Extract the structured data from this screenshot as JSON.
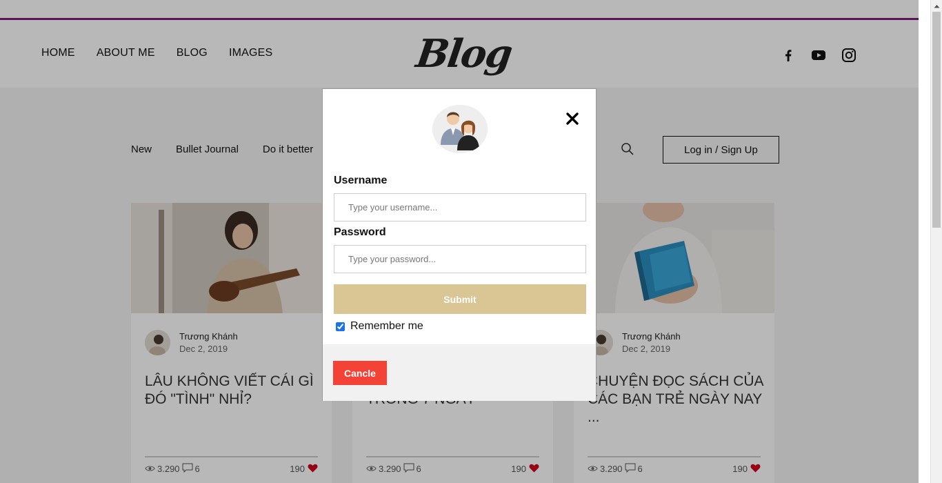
{
  "header": {
    "nav": [
      "HOME",
      "ABOUT ME",
      "BLOG",
      "IMAGES"
    ],
    "logo": "Blog",
    "social_icons": [
      "facebook-icon",
      "youtube-icon",
      "instagram-icon"
    ]
  },
  "categories": {
    "items": [
      "New",
      "Bullet Journal",
      "Do it better"
    ],
    "login_label": "Log in / Sign Up"
  },
  "posts": [
    {
      "author": "Trương Khánh",
      "date": "Dec 2, 2019",
      "title": "LÂU KHÔNG VIẾT CÁI GÌ ĐÓ \"TÌNH\" NHỈ?",
      "views": "3.290",
      "comments": "6",
      "likes": "190"
    },
    {
      "author": "",
      "date": "",
      "title": "TRONG 7 NGÀY",
      "views": "3.290",
      "comments": "6",
      "likes": "190"
    },
    {
      "author": "Trương Khánh",
      "date": "Dec 2, 2019",
      "title": "CHUYỆN ĐỌC SÁCH CỦA CÁC BẠN TRẺ NGÀY NAY ...",
      "views": "3.290",
      "comments": "6",
      "likes": "190"
    }
  ],
  "modal": {
    "username_label": "Username",
    "username_placeholder": "Type your username...",
    "password_label": "Password",
    "password_placeholder": "Type your password...",
    "submit_label": "Submit",
    "remember_label": "Remember me",
    "remember_checked": true,
    "cancel_label": "Cancle"
  },
  "colors": {
    "accent_line": "#7a1f7a",
    "submit_bg": "#dac695",
    "cancel_bg": "#f44336",
    "heart": "#d0021b"
  }
}
